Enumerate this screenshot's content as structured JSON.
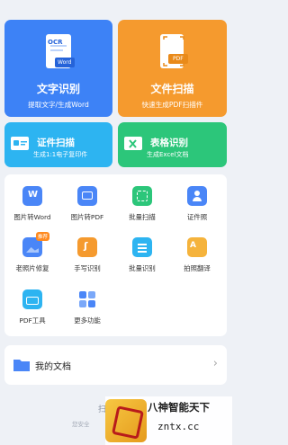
{
  "cards": {
    "ocr": {
      "title": "文字识别",
      "sub": "提取文字/生成Word",
      "illus_top": "OCR",
      "illus_tag": "Word"
    },
    "scan": {
      "title": "文件扫描",
      "sub": "快速生成PDF扫描件",
      "illus_tag": "PDF"
    },
    "id_scan": {
      "title": "证件扫描",
      "sub": "生成1:1电子复印件"
    },
    "table": {
      "title": "表格识别",
      "sub": "生成Excel文档"
    }
  },
  "tools": [
    {
      "label": "图片转Word",
      "icon": "word-doc-icon",
      "color": "#4a86f7"
    },
    {
      "label": "图片转PDF",
      "icon": "image-pdf-icon",
      "color": "#4a86f7"
    },
    {
      "label": "批量扫描",
      "icon": "batch-scan-icon",
      "color": "#2cc67a"
    },
    {
      "label": "证件照",
      "icon": "id-photo-icon",
      "color": "#4a86f7"
    },
    {
      "label": "老照片修复",
      "icon": "old-photo-icon",
      "color": "#4a86f7",
      "badge": "推荐"
    },
    {
      "label": "手写识别",
      "icon": "handwriting-icon",
      "color": "#f59a2e"
    },
    {
      "label": "批量识别",
      "icon": "batch-recognize-icon",
      "color": "#2db4f1"
    },
    {
      "label": "拍照翻译",
      "icon": "translate-icon",
      "color": "#f5b33c"
    },
    {
      "label": "PDF工具",
      "icon": "toolbox-icon",
      "color": "#2db4f1"
    },
    {
      "label": "更多功能",
      "icon": "more-grid-icon",
      "color": "#4a86f7"
    }
  ],
  "mydocs": {
    "label": "我的文档"
  },
  "footer": {
    "line1": "扫",
    "line2": "您安全"
  },
  "watermark": {
    "line1": "八神智能天下",
    "line2": "zntx.cc"
  }
}
